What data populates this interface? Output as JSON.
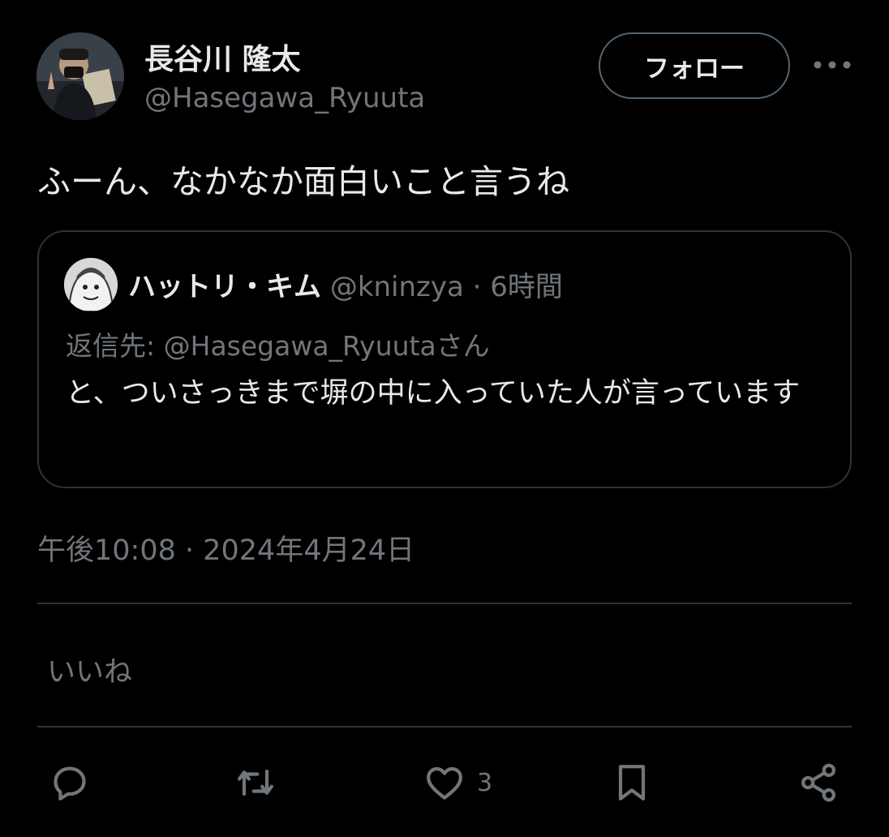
{
  "author": {
    "display_name": "長谷川 隆太",
    "handle": "@Hasegawa_Ryuuta"
  },
  "follow_label": "フォロー",
  "tweet_text": "ふーん、なかなか面白いこと言うね",
  "quote": {
    "name": "ハットリ・キム",
    "handle": "@kninzya",
    "separator": "·",
    "time": "6時間",
    "reply_prefix": "返信先:",
    "reply_handle": "@Hasegawa_Ryuuta",
    "reply_suffix": "さん",
    "text": "と、ついさっきまで塀の中に入っていた人が言っています"
  },
  "timestamp": "午後10:08 · 2024年4月24日",
  "likes_label": "いいね",
  "actions": {
    "reply_icon": "reply-icon",
    "retweet_icon": "retweet-icon",
    "like_icon": "heart-icon",
    "like_count": "3",
    "bookmark_icon": "bookmark-icon",
    "share_icon": "share-icon"
  },
  "colors": {
    "background": "#000000",
    "text_primary": "#e7e9ea",
    "text_secondary": "#71767b",
    "border": "#2f3336"
  }
}
